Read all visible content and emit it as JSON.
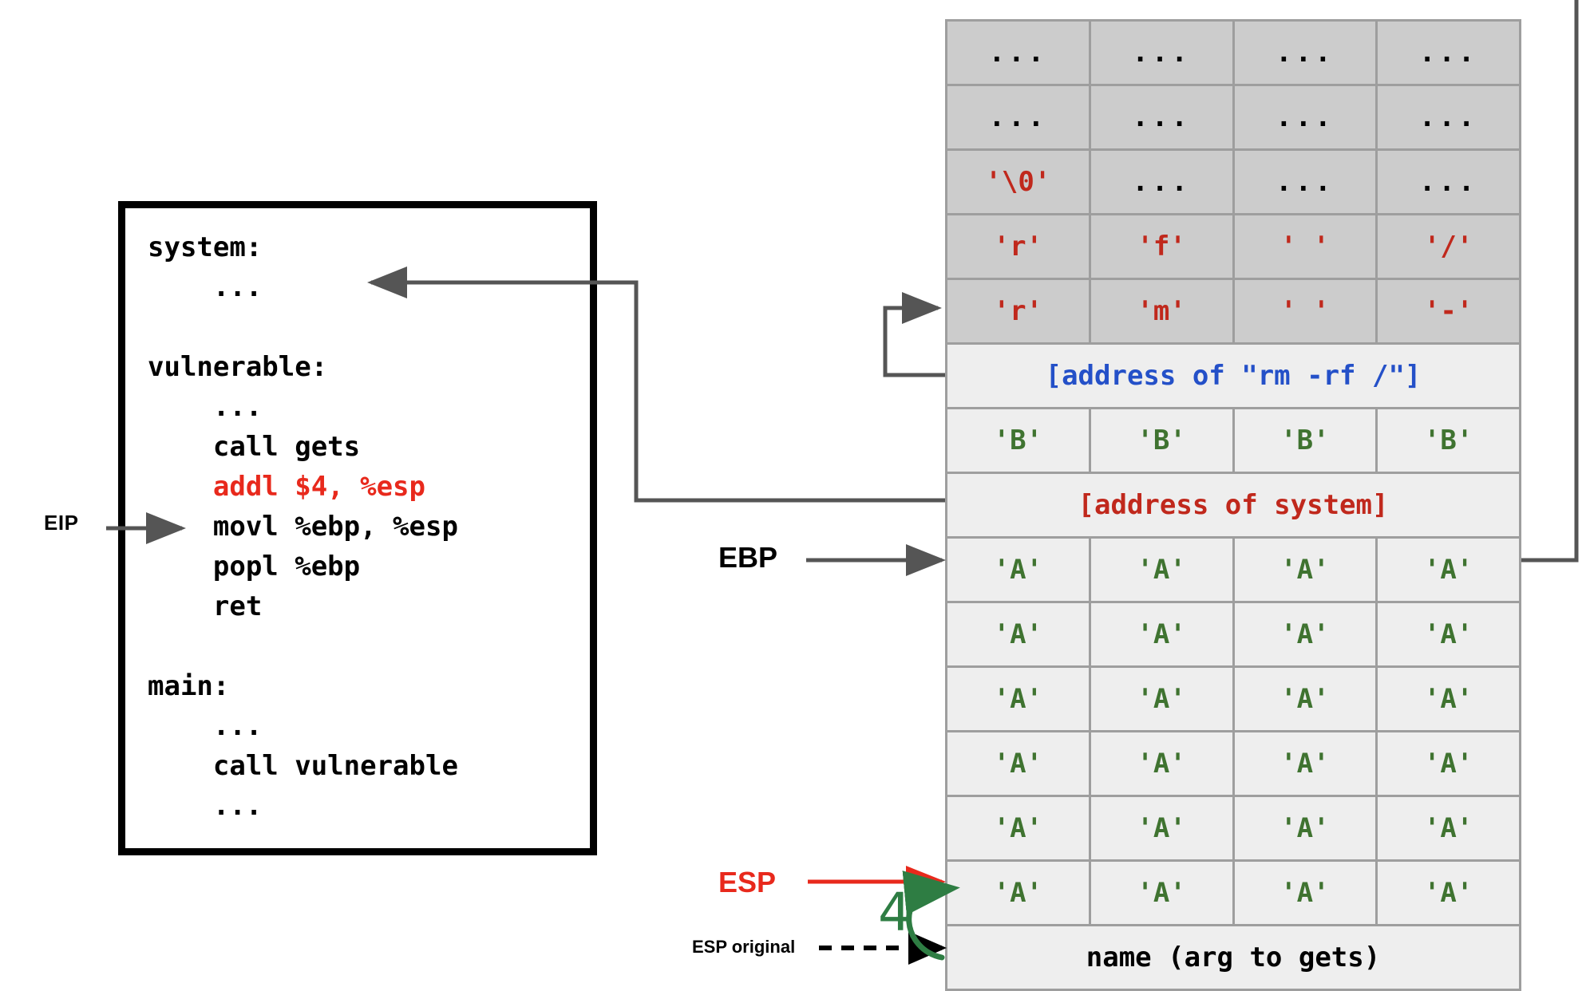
{
  "diagram": {
    "title": "Stack smashing / return-to-libc diagram",
    "code_box": {
      "lines": [
        {
          "text": "system:",
          "color": "black"
        },
        {
          "text": "    ...",
          "color": "black"
        },
        {
          "text": "",
          "color": "black"
        },
        {
          "text": "vulnerable:",
          "color": "black"
        },
        {
          "text": "    ...",
          "color": "black"
        },
        {
          "text": "    call gets",
          "color": "black"
        },
        {
          "text": "    addl $4, %esp",
          "color": "red"
        },
        {
          "text": "    movl %ebp, %esp",
          "color": "black"
        },
        {
          "text": "    popl %ebp",
          "color": "black"
        },
        {
          "text": "    ret",
          "color": "black"
        },
        {
          "text": "",
          "color": "black"
        },
        {
          "text": "main:",
          "color": "black"
        },
        {
          "text": "    ...",
          "color": "black"
        },
        {
          "text": "    call vulnerable",
          "color": "black"
        },
        {
          "text": "    ...",
          "color": "black"
        }
      ]
    },
    "labels": {
      "eip": "EIP",
      "ebp": "EBP",
      "esp": "ESP",
      "esp_original": "ESP original",
      "green_annotation": "4"
    },
    "colors": {
      "red": "#e8291c",
      "cell_red": "#c0281c",
      "green": "#3f7330",
      "blue": "#2450c8",
      "handwriting_green": "#2e7d43",
      "arrow_gray": "#555555",
      "cell_border": "#9e9e9e",
      "shade_dark": "#cccccc",
      "shade_light": "#eeeeee"
    },
    "stack_rows": [
      {
        "kind": "cells",
        "shade": "dark",
        "cells": [
          {
            "text": "...",
            "color": "dots"
          },
          {
            "text": "...",
            "color": "dots"
          },
          {
            "text": "...",
            "color": "dots"
          },
          {
            "text": "...",
            "color": "dots"
          }
        ]
      },
      {
        "kind": "cells",
        "shade": "dark",
        "cells": [
          {
            "text": "...",
            "color": "dots"
          },
          {
            "text": "...",
            "color": "dots"
          },
          {
            "text": "...",
            "color": "dots"
          },
          {
            "text": "...",
            "color": "dots"
          }
        ]
      },
      {
        "kind": "cells",
        "shade": "dark",
        "cells": [
          {
            "text": "'\\0'",
            "color": "red"
          },
          {
            "text": "...",
            "color": "dots"
          },
          {
            "text": "...",
            "color": "dots"
          },
          {
            "text": "...",
            "color": "dots"
          }
        ]
      },
      {
        "kind": "cells",
        "shade": "dark",
        "cells": [
          {
            "text": "'r'",
            "color": "red"
          },
          {
            "text": "'f'",
            "color": "red"
          },
          {
            "text": "' '",
            "color": "red"
          },
          {
            "text": "'/'",
            "color": "red"
          }
        ]
      },
      {
        "kind": "cells",
        "shade": "dark",
        "cells": [
          {
            "text": "'r'",
            "color": "red"
          },
          {
            "text": "'m'",
            "color": "red"
          },
          {
            "text": "' '",
            "color": "red"
          },
          {
            "text": "'-'",
            "color": "red"
          }
        ]
      },
      {
        "kind": "span",
        "shade": "light",
        "text": "[address of \"rm -rf /\"]",
        "color": "blue"
      },
      {
        "kind": "cells",
        "shade": "light",
        "cells": [
          {
            "text": "'B'",
            "color": "green"
          },
          {
            "text": "'B'",
            "color": "green"
          },
          {
            "text": "'B'",
            "color": "green"
          },
          {
            "text": "'B'",
            "color": "green"
          }
        ]
      },
      {
        "kind": "span",
        "shade": "light",
        "text": "[address of system]",
        "color": "red"
      },
      {
        "kind": "cells",
        "shade": "light",
        "cells": [
          {
            "text": "'A'",
            "color": "green"
          },
          {
            "text": "'A'",
            "color": "green"
          },
          {
            "text": "'A'",
            "color": "green"
          },
          {
            "text": "'A'",
            "color": "green"
          }
        ]
      },
      {
        "kind": "cells",
        "shade": "light",
        "cells": [
          {
            "text": "'A'",
            "color": "green"
          },
          {
            "text": "'A'",
            "color": "green"
          },
          {
            "text": "'A'",
            "color": "green"
          },
          {
            "text": "'A'",
            "color": "green"
          }
        ]
      },
      {
        "kind": "cells",
        "shade": "light",
        "cells": [
          {
            "text": "'A'",
            "color": "green"
          },
          {
            "text": "'A'",
            "color": "green"
          },
          {
            "text": "'A'",
            "color": "green"
          },
          {
            "text": "'A'",
            "color": "green"
          }
        ]
      },
      {
        "kind": "cells",
        "shade": "light",
        "cells": [
          {
            "text": "'A'",
            "color": "green"
          },
          {
            "text": "'A'",
            "color": "green"
          },
          {
            "text": "'A'",
            "color": "green"
          },
          {
            "text": "'A'",
            "color": "green"
          }
        ]
      },
      {
        "kind": "cells",
        "shade": "light",
        "cells": [
          {
            "text": "'A'",
            "color": "green"
          },
          {
            "text": "'A'",
            "color": "green"
          },
          {
            "text": "'A'",
            "color": "green"
          },
          {
            "text": "'A'",
            "color": "green"
          }
        ]
      },
      {
        "kind": "cells",
        "shade": "light",
        "cells": [
          {
            "text": "'A'",
            "color": "green"
          },
          {
            "text": "'A'",
            "color": "green"
          },
          {
            "text": "'A'",
            "color": "green"
          },
          {
            "text": "'A'",
            "color": "green"
          }
        ]
      },
      {
        "kind": "span",
        "shade": "light",
        "text": "name (arg to gets)",
        "color": "dark"
      }
    ]
  }
}
